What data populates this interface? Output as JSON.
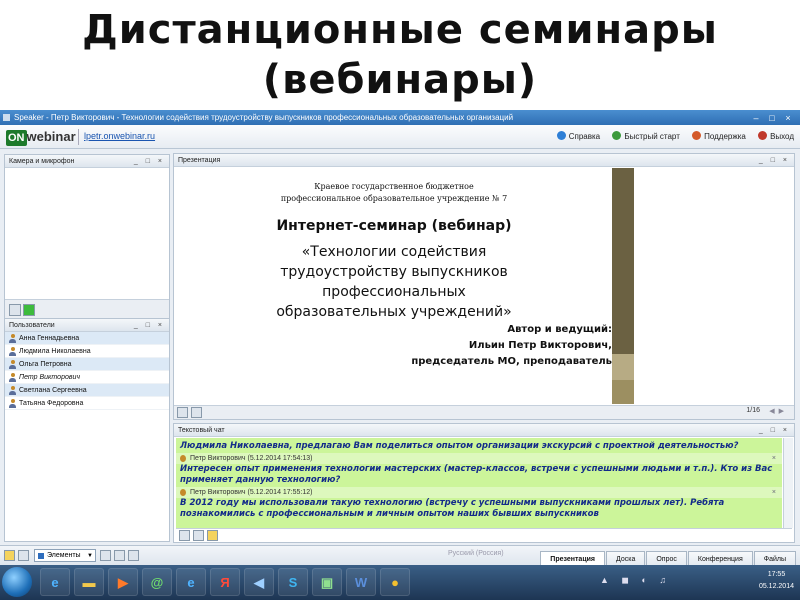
{
  "slide_title": {
    "line1": "Дистанционные семинары",
    "line2": "(вебинары)"
  },
  "window": {
    "title": "Speaker - Петр Викторович - Технологии содействия трудоустройству выпускников профессиональных образовательных организаций",
    "controls": [
      "–",
      "□",
      "×"
    ]
  },
  "appbar": {
    "logo_on": "ON",
    "logo_webinar": "webinar",
    "site_link": "lpetr.onwebinar.ru",
    "actions": [
      {
        "label": "Справка",
        "color": "#2e7fd6"
      },
      {
        "label": "Быстрый старт",
        "color": "#3c9a3c"
      },
      {
        "label": "Поддержка",
        "color": "#d45a2a"
      },
      {
        "label": "Выход",
        "color": "#c0392b"
      }
    ]
  },
  "panels": {
    "camera_title": "Камера и микрофон",
    "users_title": "Пользователи",
    "presentation_title": "Презентация",
    "chat_title": "Текстовый чат",
    "controls": "_ □ ×"
  },
  "users": [
    "Анна Геннадьевна",
    "Людмила Николаевна",
    "Ольга Петровна",
    "Петр Викторович",
    "Светлана Сергеевна",
    "Татьяна Федоровна"
  ],
  "presentation_slide": {
    "org_line1": "Краевое государственное бюджетное",
    "org_line2": "профессиональное образовательное учреждение № 7",
    "heading": "Интернет-семинар (вебинар)",
    "topic_line1": "«Технологии содействия",
    "topic_line2": "трудоустройству выпускников",
    "topic_line3": "профессиональных",
    "topic_line4": "образовательных учреждений»",
    "author_label": "Автор и ведущий:",
    "author_name": "Ильин Петр Викторович,",
    "author_role": "председатель МО, преподаватель"
  },
  "pager": "1/16",
  "chat": {
    "messages": [
      {
        "type": "text",
        "text": "Людмила Николаевна, предлагаю Вам поделиться опытом организации экскурсий с проектной деятельностью?"
      },
      {
        "type": "head",
        "text": "Петр Викторович (5.12.2014 17:54:13)"
      },
      {
        "type": "text",
        "text": "Интересен опыт применения технологии мастерских (мастер-классов, встречи с успешными людьми и т.п.). Кто из Вас применяет данную технологию?"
      },
      {
        "type": "head",
        "text": "Петр Викторович (5.12.2014 17:55:12)"
      },
      {
        "type": "text",
        "text": "В 2012 году мы использовали такую технологию (встречу с успешными выпускниками прошлых лет). Ребята познакомились с профессиональным и личным опытом наших бывших выпускников"
      }
    ]
  },
  "statusbar": {
    "elements_label": "Элементы",
    "language": "Русский (Россия)",
    "tabs": [
      "Презентация",
      "Доска",
      "Опрос",
      "Конференция",
      "Файлы"
    ],
    "active_tab": 0
  },
  "taskbar": {
    "apps": [
      {
        "name": "ie-icon",
        "glyph": "e",
        "color": "#4fb3ff"
      },
      {
        "name": "folder-icon",
        "glyph": "▬",
        "color": "#f2c94c"
      },
      {
        "name": "media-player-icon",
        "glyph": "▶",
        "color": "#ff7a2a"
      },
      {
        "name": "mail-icon",
        "glyph": "@",
        "color": "#6fdc6f"
      },
      {
        "name": "ie-icon-2",
        "glyph": "e",
        "color": "#4fb3ff"
      },
      {
        "name": "yandex-icon",
        "glyph": "Я",
        "color": "#ff4a3a"
      },
      {
        "name": "sound-icon",
        "glyph": "◀",
        "color": "#9fd0ff"
      },
      {
        "name": "skype-icon",
        "glyph": "S",
        "color": "#3fb6f2"
      },
      {
        "name": "image-viewer-icon",
        "glyph": "▣",
        "color": "#8fe08f"
      },
      {
        "name": "word-icon",
        "glyph": "W",
        "color": "#5b8fdc"
      },
      {
        "name": "chrome-icon",
        "glyph": "●",
        "color": "#f3c02f"
      }
    ],
    "time": "17:55",
    "date": "05.12.2014"
  }
}
